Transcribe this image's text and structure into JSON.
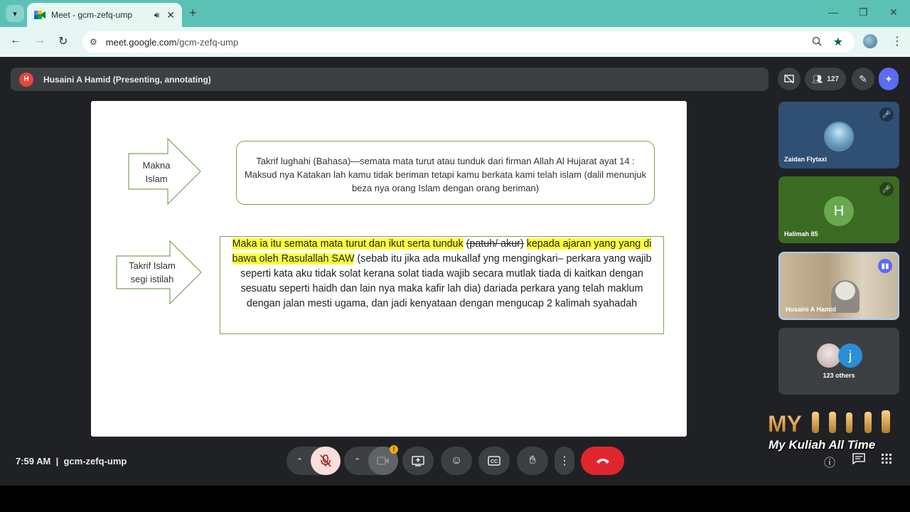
{
  "browser": {
    "tab_title": "Meet - gcm-zefq-ump",
    "url_host": "meet.google.com",
    "url_path": "/gcm-zefq-ump"
  },
  "presenter_bar": {
    "initial": "H",
    "label": "Husaini A Hamid (Presenting, annotating)"
  },
  "top_controls": {
    "participant_count": "127"
  },
  "slide": {
    "arrow1_label": "Makna\nIslam",
    "arrow2_label": "Takrif Islam\nsegi istilah",
    "box1_text": "Takrif lughahi (Bahasa)—semata mata turut atau tunduk dari firman Allah Al Hujarat ayat 14 : Maksud nya Katakan lah kamu tidak beriman tetapi kamu berkata kami telah islam (dalil menunjuk beza nya orang Islam dengan orang beriman)",
    "box2_hl1": "Maka ia itu semata mata turut dan ikut serta tunduk",
    "box2_strike": "(patuh/ akur)",
    "box2_hl2": "kepada ajaran yang yang di bawa oleh Rasulallah SAW",
    "box2_rest": "(sebab itu jika ada mukallaf yng mengingkari– perkara yang wajib seperti kata aku tidak solat kerana solat tiada wajib secara mutlak tiada di kaitkan dengan sesuatu seperti haidh dan lain nya maka kafir lah dia) dariada perkara yang telah maklum dengan jalan mesti ugama,  dan jadi kenyataan dengan mengucap 2 kalimah syahadah"
  },
  "participants": [
    {
      "name": "Zaidan Flytaxi",
      "color": "#2f4f73"
    },
    {
      "name": "Halimah 85",
      "initial": "H",
      "color": "#3b6b22",
      "avatar_color": "#6aa84f"
    },
    {
      "name": "Husaini A Hamid",
      "color": "#b9a98f"
    },
    {
      "name": "123 others",
      "initial": "j",
      "color": "#3c4043",
      "avatar_color": "#2b8fd6"
    }
  ],
  "bottom_bar": {
    "time": "7:59 AM",
    "separator": "|",
    "meeting_code": "gcm-zefq-ump"
  },
  "watermark": {
    "logo": "MY",
    "text": "My Kuliah All Time"
  },
  "colors": {
    "teal_chrome": "#5cc1b5",
    "meet_bg": "#202124",
    "end_call": "#e0262d",
    "highlight": "#ffff3b",
    "box_border": "#7aa55a"
  }
}
